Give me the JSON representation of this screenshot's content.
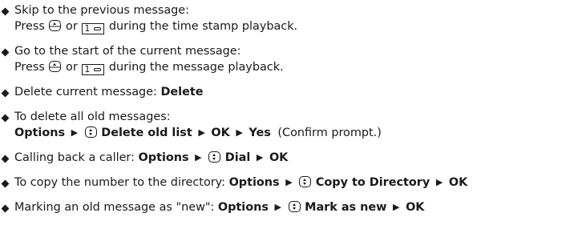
{
  "items": [
    {
      "line1": "Skip to the previous message:",
      "line2_pre": "Press",
      "line2_or": "or",
      "digit": "1",
      "line2_post": "during the time stamp playback."
    },
    {
      "line1": "Go to the start of the current message:",
      "line2_pre": "Press",
      "line2_or": "or",
      "digit": "1",
      "line2_post": "during the message playback."
    },
    {
      "text": "Delete current message:",
      "bold": "Delete"
    },
    {
      "line1": "To delete all old messages:",
      "b1": "Options",
      "b2": "Delete old list",
      "b3": "OK",
      "b4": "Yes",
      "note": "(Confirm prompt.)"
    },
    {
      "text": "Calling back a caller:",
      "b1": "Options",
      "b2": "Dial",
      "b3": "OK"
    },
    {
      "text": "To copy the number to the directory:",
      "b1": "Options",
      "b2": "Copy to Directory",
      "b3": "OK"
    },
    {
      "text": "Marking an old message as \"new\":",
      "b1": "Options",
      "b2": "Mark as new",
      "b3": "OK"
    }
  ],
  "separator": "▶",
  "icons": [
    "navigation-key-up-icon",
    "digit-one-key-icon",
    "navigation-key-icon",
    "bullet-diamond-icon"
  ]
}
